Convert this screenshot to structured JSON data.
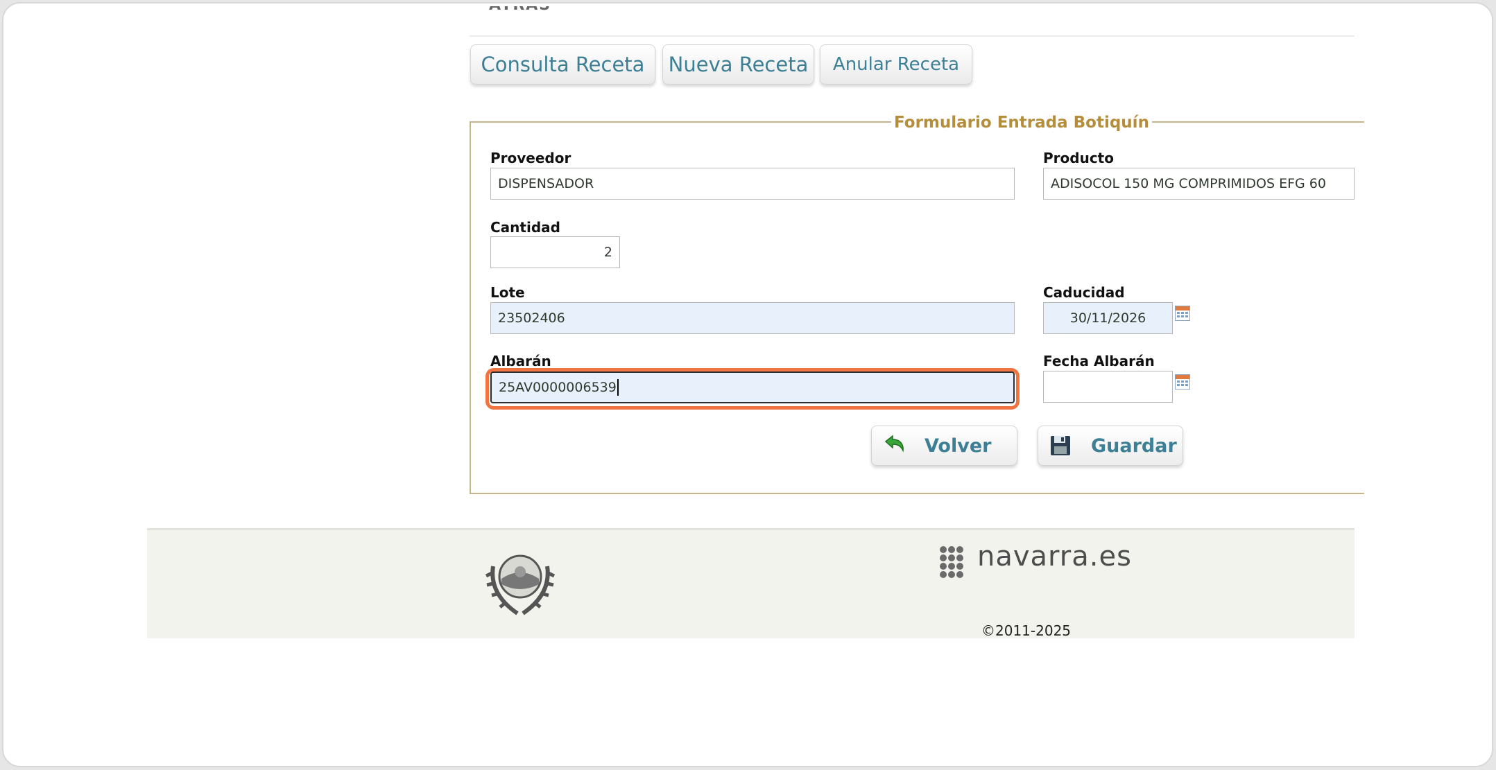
{
  "header": {
    "cut_text": "ATRÁS"
  },
  "tabs": [
    {
      "label": "Consulta Receta"
    },
    {
      "label": "Nueva Receta"
    },
    {
      "label": "Anular Receta"
    }
  ],
  "form": {
    "legend": "Formulario Entrada Botiquín",
    "proveedor": {
      "label": "Proveedor",
      "value": "DISPENSADOR"
    },
    "producto": {
      "label": "Producto",
      "value": "ADISOCOL 150 MG COMPRIMIDOS EFG  60"
    },
    "cantidad": {
      "label": "Cantidad",
      "value": "2"
    },
    "lote": {
      "label": "Lote",
      "value": "23502406"
    },
    "caducidad": {
      "label": "Caducidad",
      "value": "30/11/2026"
    },
    "albaran": {
      "label": "Albarán",
      "value": "25AV0000006539"
    },
    "fecha_albaran": {
      "label": "Fecha Albarán",
      "value": ""
    }
  },
  "buttons": {
    "volver": "Volver",
    "guardar": "Guardar"
  },
  "footer": {
    "logo_text": "navarra.es",
    "copyright": "©2011-2025"
  },
  "colors": {
    "tab_text": "#3d7f95",
    "legend": "#b58e3c",
    "highlight": "#f07340",
    "input_blue": "#e8f0fb"
  },
  "icons": [
    "calendar-icon",
    "undo-arrow-icon",
    "floppy-disk-icon",
    "navarra-seal-icon",
    "navarra-dots-logo-icon"
  ]
}
